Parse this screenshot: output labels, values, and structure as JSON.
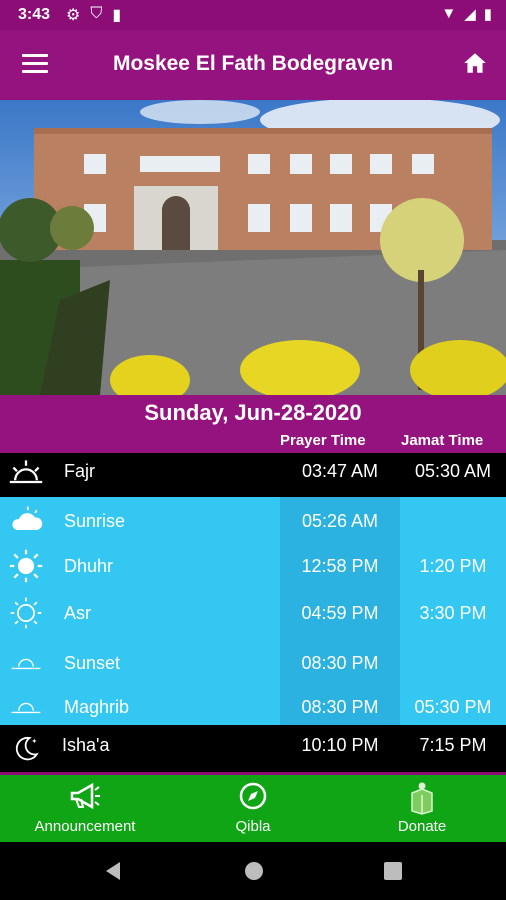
{
  "status": {
    "time": "3:43"
  },
  "app": {
    "title": "Moskee El Fath Bodegraven"
  },
  "date_band": {
    "date": "Sunday, Jun-28-2020",
    "col_prayer": "Prayer Time",
    "col_jamat": "Jamat Time"
  },
  "prayers": [
    {
      "name": "Fajr",
      "prayer_time": "03:47 AM",
      "jamat_time": "05:30 AM",
      "icon": "sunrise-icon"
    },
    {
      "name": "Sunrise",
      "prayer_time": "05:26 AM",
      "jamat_time": "",
      "icon": "cloud-icon"
    },
    {
      "name": "Dhuhr",
      "prayer_time": "12:58 PM",
      "jamat_time": "1:20 PM",
      "icon": "sun-icon"
    },
    {
      "name": "Asr",
      "prayer_time": "04:59 PM",
      "jamat_time": "3:30 PM",
      "icon": "sun-outline-icon"
    },
    {
      "name": "Sunset",
      "prayer_time": "08:30 PM",
      "jamat_time": "",
      "icon": "sunset-icon"
    },
    {
      "name": "Maghrib",
      "prayer_time": "08:30 PM",
      "jamat_time": "05:30 PM",
      "icon": "sunset-icon"
    },
    {
      "name": "Isha'a",
      "prayer_time": "10:10 PM",
      "jamat_time": "7:15 PM",
      "icon": "moon-icon"
    }
  ],
  "bottom_nav": {
    "announcement": "Announcement",
    "qibla": "Qibla",
    "donate": "Donate"
  },
  "colors": {
    "brand": "#95137e",
    "blue": "#33c7f2",
    "green": "#0fa514"
  }
}
